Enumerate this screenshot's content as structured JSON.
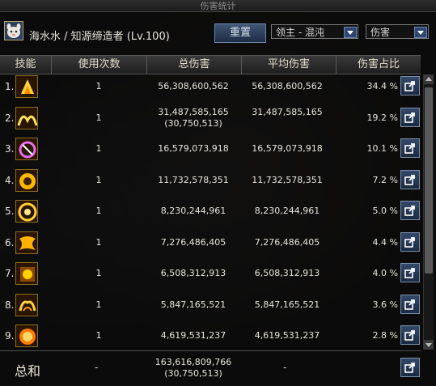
{
  "window": {
    "title": "伤害统计"
  },
  "character": {
    "name": "海水水 / 知源缔造者 (Lv.100)"
  },
  "toolbar": {
    "reset_label": "重置",
    "target_select": "领主 - 混沌",
    "type_select": "伤害"
  },
  "table": {
    "headers": {
      "skill": "技能",
      "count": "使用次数",
      "total": "总伤害",
      "avg": "平均伤害",
      "pct": "伤害占比"
    },
    "rows": [
      {
        "rank": "1.",
        "count": "1",
        "total": "56,308,600,562",
        "total_sub": "",
        "avg": "56,308,600,562",
        "pct": "34.4 %",
        "icon": "skill-icon-1"
      },
      {
        "rank": "2.",
        "count": "1",
        "total": "31,487,585,165",
        "total_sub": "(30,750,513)",
        "avg": "31,487,585,165",
        "pct": "19.2 %",
        "icon": "skill-icon-2"
      },
      {
        "rank": "3.",
        "count": "1",
        "total": "16,579,073,918",
        "total_sub": "",
        "avg": "16,579,073,918",
        "pct": "10.1 %",
        "icon": "skill-icon-3"
      },
      {
        "rank": "4.",
        "count": "1",
        "total": "11,732,578,351",
        "total_sub": "",
        "avg": "11,732,578,351",
        "pct": "7.2 %",
        "icon": "skill-icon-4"
      },
      {
        "rank": "5.",
        "count": "1",
        "total": "8,230,244,961",
        "total_sub": "",
        "avg": "8,230,244,961",
        "pct": "5.0 %",
        "icon": "skill-icon-5"
      },
      {
        "rank": "6.",
        "count": "1",
        "total": "7,276,486,405",
        "total_sub": "",
        "avg": "7,276,486,405",
        "pct": "4.4 %",
        "icon": "skill-icon-6"
      },
      {
        "rank": "7.",
        "count": "1",
        "total": "6,508,312,913",
        "total_sub": "",
        "avg": "6,508,312,913",
        "pct": "4.0 %",
        "icon": "skill-icon-7"
      },
      {
        "rank": "8.",
        "count": "1",
        "total": "5,847,165,521",
        "total_sub": "",
        "avg": "5,847,165,521",
        "pct": "3.6 %",
        "icon": "skill-icon-8"
      },
      {
        "rank": "9.",
        "count": "1",
        "total": "4,619,531,237",
        "total_sub": "",
        "avg": "4,619,531,237",
        "pct": "2.8 %",
        "icon": "skill-icon-9"
      }
    ]
  },
  "summary": {
    "label": "总和",
    "count": "-",
    "total": "163,616,809,766",
    "total_sub": "(30,750,513)",
    "avg": "-"
  },
  "colors": {
    "accent_gold": "#d9a521",
    "button_blue": "#2d4670"
  }
}
